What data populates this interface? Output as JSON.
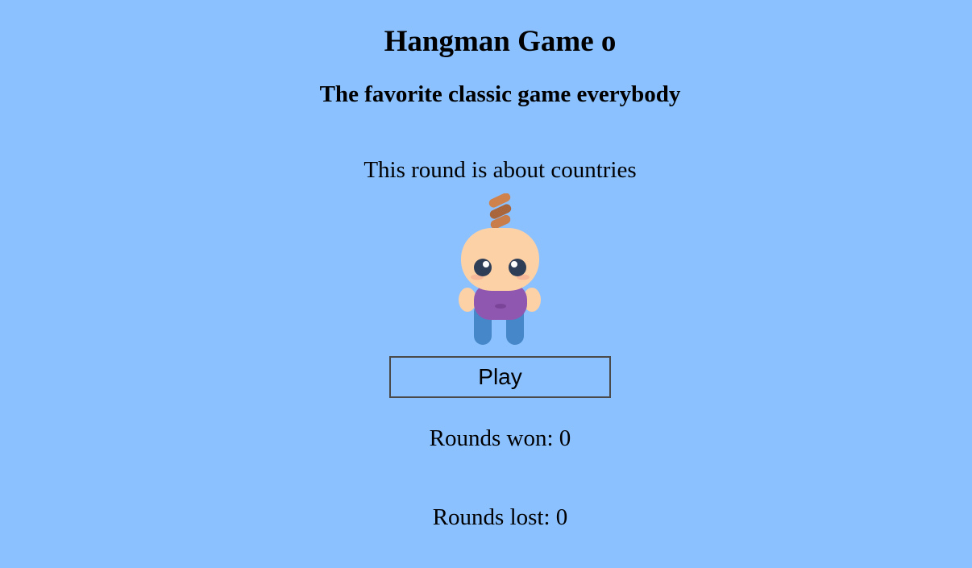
{
  "header": {
    "title": "Hangman Game o",
    "subtitle": "The favorite classic game everybody"
  },
  "round": {
    "topic_text": "This round is about countries"
  },
  "character": {
    "icon": "baby-character-icon",
    "colors": {
      "hair": "#c97d4a",
      "skin": "#fdd1a6",
      "shirt": "#8f57b0",
      "pants": "#4687c9",
      "eyes": "#2e3e57",
      "background": "#8bc1ff"
    }
  },
  "controls": {
    "play_label": "Play"
  },
  "stats": {
    "won_text": "Rounds won: 0",
    "lost_text": "Rounds lost: 0"
  }
}
